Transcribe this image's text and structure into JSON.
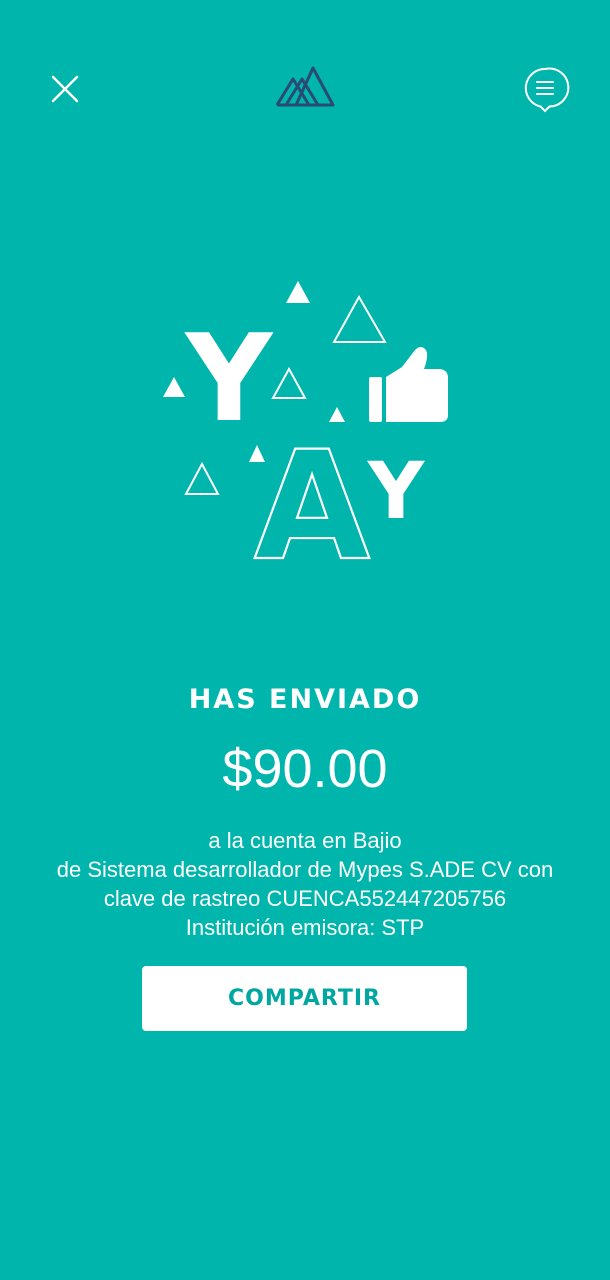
{
  "header": {
    "close_icon": "close-icon",
    "logo_icon": "mountains-logo-icon",
    "chat_icon": "chat-bubble-icon"
  },
  "illustration": {
    "icon": "yay-thumbs-up-illustration",
    "letters": [
      "Y",
      "A",
      "Y"
    ]
  },
  "confirmation": {
    "title": "HAS ENVIADO",
    "amount": "$90.00",
    "lines": [
      "a la cuenta en Bajio",
      "de Sistema desarrollador de Mypes S.ADE CV con",
      "clave de rastreo CUENCA552447205756",
      "Institución emisora: STP"
    ]
  },
  "actions": {
    "share_label": "COMPARTIR"
  },
  "colors": {
    "background": "#00b5ac",
    "text": "#ffffff",
    "logo": "#2a4a75",
    "button_text": "#00a7a0"
  }
}
